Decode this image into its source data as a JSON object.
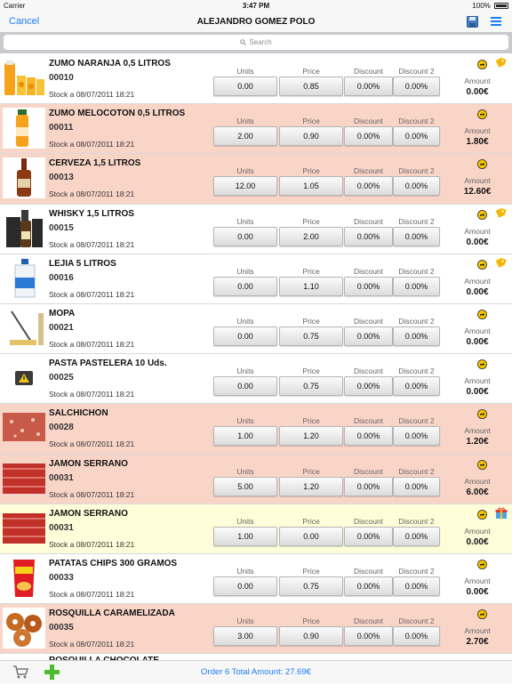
{
  "status": {
    "carrier": "Carrier",
    "time": "3:47 PM",
    "battery": "100%"
  },
  "nav": {
    "cancel": "Cancel",
    "title": "ALEJANDRO GOMEZ POLO"
  },
  "search": {
    "placeholder": "Search"
  },
  "labels": {
    "units": "Units",
    "price": "Price",
    "discount": "Discount",
    "discount2": "Discount 2",
    "amount": "Amount"
  },
  "colors": {
    "accent": "#1a7ef3",
    "pink_row": "#f9d5c8",
    "yellow_row": "#fdfdd9"
  },
  "items": [
    {
      "name": "ZUMO NARANJA 0,5 LITROS",
      "code": "00010",
      "stock": "Stock a 08/07/2011 18:21",
      "units": "0.00",
      "price": "0.85",
      "discount": "0.00%",
      "discount2": "0.00%",
      "amount": "0.00€",
      "bg": "white",
      "image": "orange-juice-image",
      "extra_icon": "tag-icon"
    },
    {
      "name": "ZUMO MELOCOTON 0,5 LITROS",
      "code": "00011",
      "stock": "Stock a 08/07/2011 18:21",
      "units": "2.00",
      "price": "0.90",
      "discount": "0.00%",
      "discount2": "0.00%",
      "amount": "1.80€",
      "bg": "pink",
      "image": "peach-juice-image",
      "extra_icon": ""
    },
    {
      "name": "CERVEZA 1,5 LITROS",
      "code": "00013",
      "stock": "Stock a 08/07/2011 18:21",
      "units": "12.00",
      "price": "1.05",
      "discount": "0.00%",
      "discount2": "0.00%",
      "amount": "12.60€",
      "bg": "pink",
      "image": "beer-bottle-image",
      "extra_icon": ""
    },
    {
      "name": "WHISKY 1,5 LITROS",
      "code": "00015",
      "stock": "Stock a 08/07/2011 18:21",
      "units": "0.00",
      "price": "2.00",
      "discount": "0.00%",
      "discount2": "0.00%",
      "amount": "0.00€",
      "bg": "white",
      "image": "whisky-image",
      "extra_icon": "tag-icon"
    },
    {
      "name": "LEJIA 5 LITROS",
      "code": "00016",
      "stock": "Stock a 08/07/2011 18:21",
      "units": "0.00",
      "price": "1.10",
      "discount": "0.00%",
      "discount2": "0.00%",
      "amount": "0.00€",
      "bg": "white",
      "image": "bleach-image",
      "extra_icon": "tag-icon"
    },
    {
      "name": "MOPA",
      "code": "00021",
      "stock": "Stock a 08/07/2011 18:21",
      "units": "0.00",
      "price": "0.75",
      "discount": "0.00%",
      "discount2": "0.00%",
      "amount": "0.00€",
      "bg": "white",
      "image": "mop-image",
      "extra_icon": ""
    },
    {
      "name": "PASTA PASTELERA 10 Uds.",
      "code": "00025",
      "stock": "Stock a 08/07/2011 18:21",
      "units": "0.00",
      "price": "0.75",
      "discount": "0.00%",
      "discount2": "0.00%",
      "amount": "0.00€",
      "bg": "white",
      "image": "warning-placeholder-image",
      "extra_icon": ""
    },
    {
      "name": "SALCHICHON",
      "code": "00028",
      "stock": "Stock a 08/07/2011 18:21",
      "units": "1.00",
      "price": "1.20",
      "discount": "0.00%",
      "discount2": "0.00%",
      "amount": "1.20€",
      "bg": "pink",
      "image": "salchichon-image",
      "extra_icon": ""
    },
    {
      "name": "JAMON SERRANO",
      "code": "00031",
      "stock": "Stock a 08/07/2011 18:21",
      "units": "5.00",
      "price": "1.20",
      "discount": "0.00%",
      "discount2": "0.00%",
      "amount": "6.00€",
      "bg": "pink",
      "image": "ham-image",
      "extra_icon": ""
    },
    {
      "name": "JAMON SERRANO",
      "code": "00031",
      "stock": "Stock a 08/07/2011 18:21",
      "units": "1.00",
      "price": "0.00",
      "discount": "0.00%",
      "discount2": "0.00%",
      "amount": "0.00€",
      "bg": "yellow",
      "image": "ham-image",
      "extra_icon": "gift-icon"
    },
    {
      "name": "PATATAS CHIPS 300 GRAMOS",
      "code": "00033",
      "stock": "Stock a 08/07/2011 18:21",
      "units": "0.00",
      "price": "0.75",
      "discount": "0.00%",
      "discount2": "0.00%",
      "amount": "0.00€",
      "bg": "white",
      "image": "chips-bag-image",
      "extra_icon": ""
    },
    {
      "name": "ROSQUILLA CARAMELIZADA",
      "code": "00035",
      "stock": "Stock a 08/07/2011 18:21",
      "units": "3.00",
      "price": "0.90",
      "discount": "0.00%",
      "discount2": "0.00%",
      "amount": "2.70€",
      "bg": "pink",
      "image": "donuts-image",
      "extra_icon": ""
    }
  ],
  "partial_item": {
    "name": "ROSQUILLA CHOCOLATE"
  },
  "footer": {
    "total": "Order 6 Total Amount: 27.69€"
  }
}
